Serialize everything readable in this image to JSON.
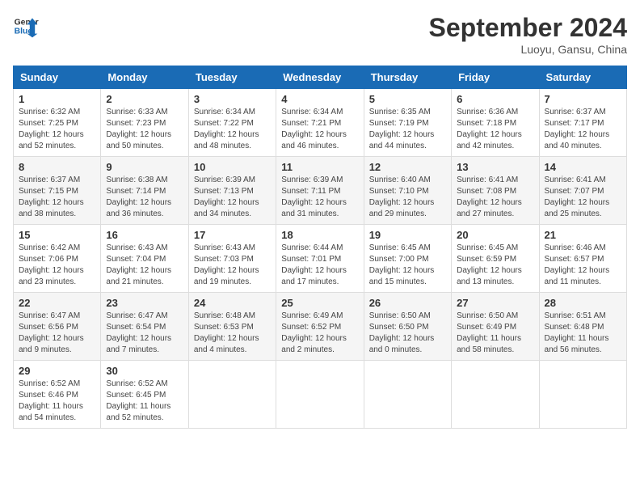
{
  "header": {
    "logo_line1": "General",
    "logo_line2": "Blue",
    "month_title": "September 2024",
    "subtitle": "Luoyu, Gansu, China"
  },
  "days_of_week": [
    "Sunday",
    "Monday",
    "Tuesday",
    "Wednesday",
    "Thursday",
    "Friday",
    "Saturday"
  ],
  "weeks": [
    [
      {
        "day": "1",
        "content": "Sunrise: 6:32 AM\nSunset: 7:25 PM\nDaylight: 12 hours\nand 52 minutes."
      },
      {
        "day": "2",
        "content": "Sunrise: 6:33 AM\nSunset: 7:23 PM\nDaylight: 12 hours\nand 50 minutes."
      },
      {
        "day": "3",
        "content": "Sunrise: 6:34 AM\nSunset: 7:22 PM\nDaylight: 12 hours\nand 48 minutes."
      },
      {
        "day": "4",
        "content": "Sunrise: 6:34 AM\nSunset: 7:21 PM\nDaylight: 12 hours\nand 46 minutes."
      },
      {
        "day": "5",
        "content": "Sunrise: 6:35 AM\nSunset: 7:19 PM\nDaylight: 12 hours\nand 44 minutes."
      },
      {
        "day": "6",
        "content": "Sunrise: 6:36 AM\nSunset: 7:18 PM\nDaylight: 12 hours\nand 42 minutes."
      },
      {
        "day": "7",
        "content": "Sunrise: 6:37 AM\nSunset: 7:17 PM\nDaylight: 12 hours\nand 40 minutes."
      }
    ],
    [
      {
        "day": "8",
        "content": "Sunrise: 6:37 AM\nSunset: 7:15 PM\nDaylight: 12 hours\nand 38 minutes."
      },
      {
        "day": "9",
        "content": "Sunrise: 6:38 AM\nSunset: 7:14 PM\nDaylight: 12 hours\nand 36 minutes."
      },
      {
        "day": "10",
        "content": "Sunrise: 6:39 AM\nSunset: 7:13 PM\nDaylight: 12 hours\nand 34 minutes."
      },
      {
        "day": "11",
        "content": "Sunrise: 6:39 AM\nSunset: 7:11 PM\nDaylight: 12 hours\nand 31 minutes."
      },
      {
        "day": "12",
        "content": "Sunrise: 6:40 AM\nSunset: 7:10 PM\nDaylight: 12 hours\nand 29 minutes."
      },
      {
        "day": "13",
        "content": "Sunrise: 6:41 AM\nSunset: 7:08 PM\nDaylight: 12 hours\nand 27 minutes."
      },
      {
        "day": "14",
        "content": "Sunrise: 6:41 AM\nSunset: 7:07 PM\nDaylight: 12 hours\nand 25 minutes."
      }
    ],
    [
      {
        "day": "15",
        "content": "Sunrise: 6:42 AM\nSunset: 7:06 PM\nDaylight: 12 hours\nand 23 minutes."
      },
      {
        "day": "16",
        "content": "Sunrise: 6:43 AM\nSunset: 7:04 PM\nDaylight: 12 hours\nand 21 minutes."
      },
      {
        "day": "17",
        "content": "Sunrise: 6:43 AM\nSunset: 7:03 PM\nDaylight: 12 hours\nand 19 minutes."
      },
      {
        "day": "18",
        "content": "Sunrise: 6:44 AM\nSunset: 7:01 PM\nDaylight: 12 hours\nand 17 minutes."
      },
      {
        "day": "19",
        "content": "Sunrise: 6:45 AM\nSunset: 7:00 PM\nDaylight: 12 hours\nand 15 minutes."
      },
      {
        "day": "20",
        "content": "Sunrise: 6:45 AM\nSunset: 6:59 PM\nDaylight: 12 hours\nand 13 minutes."
      },
      {
        "day": "21",
        "content": "Sunrise: 6:46 AM\nSunset: 6:57 PM\nDaylight: 12 hours\nand 11 minutes."
      }
    ],
    [
      {
        "day": "22",
        "content": "Sunrise: 6:47 AM\nSunset: 6:56 PM\nDaylight: 12 hours\nand 9 minutes."
      },
      {
        "day": "23",
        "content": "Sunrise: 6:47 AM\nSunset: 6:54 PM\nDaylight: 12 hours\nand 7 minutes."
      },
      {
        "day": "24",
        "content": "Sunrise: 6:48 AM\nSunset: 6:53 PM\nDaylight: 12 hours\nand 4 minutes."
      },
      {
        "day": "25",
        "content": "Sunrise: 6:49 AM\nSunset: 6:52 PM\nDaylight: 12 hours\nand 2 minutes."
      },
      {
        "day": "26",
        "content": "Sunrise: 6:50 AM\nSunset: 6:50 PM\nDaylight: 12 hours\nand 0 minutes."
      },
      {
        "day": "27",
        "content": "Sunrise: 6:50 AM\nSunset: 6:49 PM\nDaylight: 11 hours\nand 58 minutes."
      },
      {
        "day": "28",
        "content": "Sunrise: 6:51 AM\nSunset: 6:48 PM\nDaylight: 11 hours\nand 56 minutes."
      }
    ],
    [
      {
        "day": "29",
        "content": "Sunrise: 6:52 AM\nSunset: 6:46 PM\nDaylight: 11 hours\nand 54 minutes."
      },
      {
        "day": "30",
        "content": "Sunrise: 6:52 AM\nSunset: 6:45 PM\nDaylight: 11 hours\nand 52 minutes."
      },
      {
        "day": "",
        "content": ""
      },
      {
        "day": "",
        "content": ""
      },
      {
        "day": "",
        "content": ""
      },
      {
        "day": "",
        "content": ""
      },
      {
        "day": "",
        "content": ""
      }
    ]
  ]
}
